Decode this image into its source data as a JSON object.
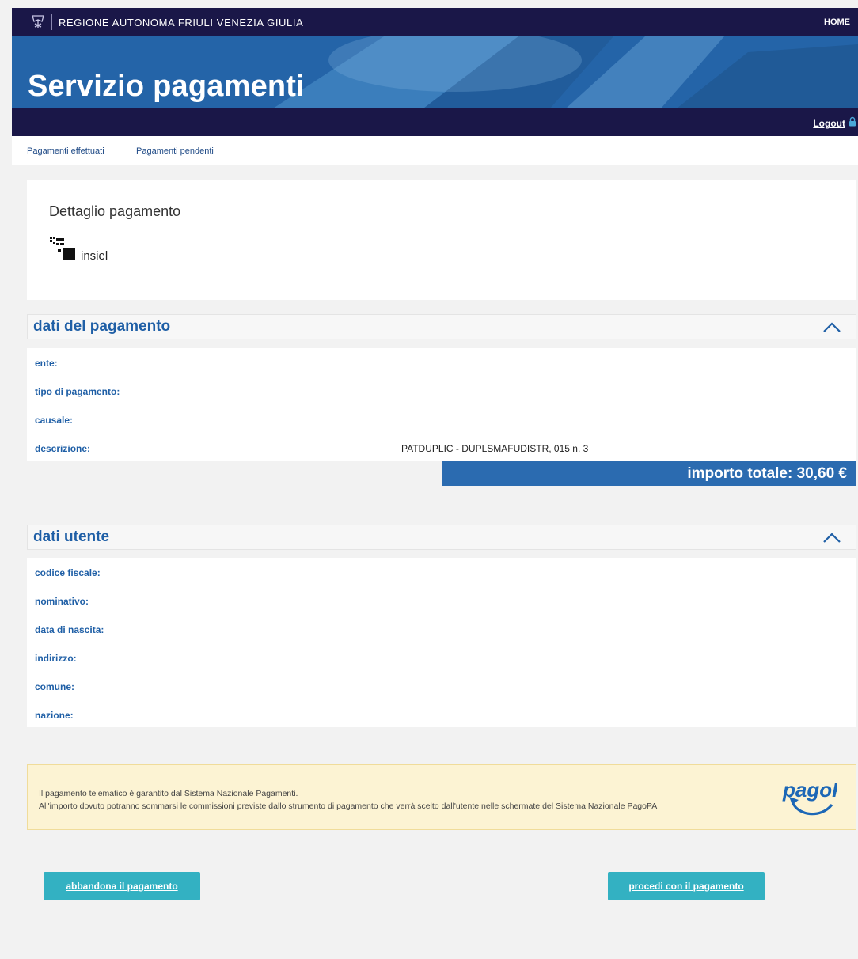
{
  "header": {
    "region_name": "REGIONE AUTONOMA FRIULI VENEZIA GIULIA",
    "home_label": "HOME",
    "logo_icon": "region-crest-icon"
  },
  "banner": {
    "title": "Servizio pagamenti"
  },
  "account": {
    "logout_label": "Logout",
    "lock_icon": "lock-icon"
  },
  "nav": {
    "items": [
      {
        "label": "Pagamenti effettuati"
      },
      {
        "label": "Pagamenti pendenti"
      }
    ]
  },
  "detail": {
    "title": "Dettaglio pagamento",
    "provider_name": "insiel"
  },
  "payment_section": {
    "title": "dati del pagamento",
    "fields": [
      {
        "label": "ente:",
        "value": ""
      },
      {
        "label": "tipo di pagamento:",
        "value": ""
      },
      {
        "label": "causale:",
        "value": ""
      },
      {
        "label": "descrizione:",
        "value": "PATDUPLIC - DUPLSMAFUDISTR, 015 n. 3"
      }
    ],
    "total_label": "importo totale: 30,60 €"
  },
  "user_section": {
    "title": "dati utente",
    "fields": [
      {
        "label": "codice fiscale:",
        "value": ""
      },
      {
        "label": "nominativo:",
        "value": ""
      },
      {
        "label": "data di nascita:",
        "value": ""
      },
      {
        "label": "indirizzo:",
        "value": ""
      },
      {
        "label": "comune:",
        "value": ""
      },
      {
        "label": "nazione:",
        "value": ""
      }
    ]
  },
  "notice": {
    "line1": "Il pagamento telematico è garantito dal Sistema Nazionale Pagamenti.",
    "line2": "All'importo dovuto potranno sommarsi le commissioni previste dallo strumento di pagamento che verrà scelto dall'utente nelle schermate del Sistema Nazionale PagoPA",
    "logo_text": "pagoPA"
  },
  "actions": {
    "abandon_label": "abbandona il pagamento",
    "proceed_label": "procedi con il pagamento"
  },
  "colors": {
    "header_bg": "#1a1748",
    "accent_blue": "#1f5fa6",
    "total_bg": "#2b6bb0",
    "button_bg": "#33b1c2",
    "notice_bg": "#fcf3d3"
  }
}
